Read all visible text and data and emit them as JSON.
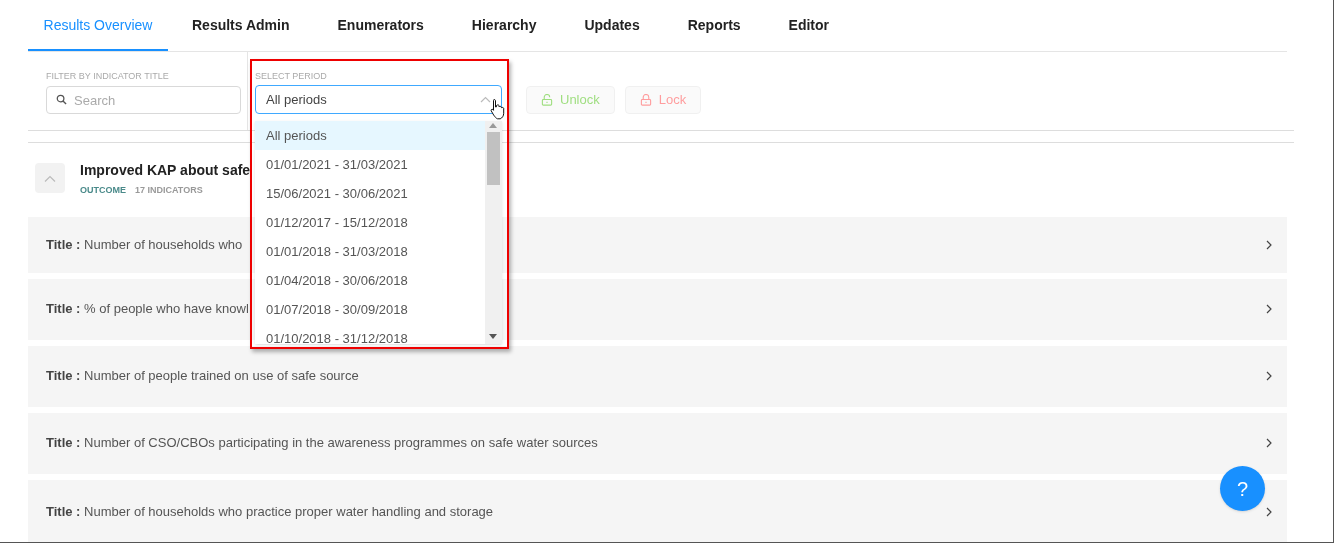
{
  "tabs": [
    {
      "label": "Results Overview",
      "selected": true
    },
    {
      "label": "Results Admin",
      "selected": false
    },
    {
      "label": "Enumerators",
      "selected": false
    },
    {
      "label": "Hierarchy",
      "selected": false
    },
    {
      "label": "Updates",
      "selected": false
    },
    {
      "label": "Reports",
      "selected": false
    },
    {
      "label": "Editor",
      "selected": false
    }
  ],
  "filter": {
    "label": "FILTER BY INDICATOR TITLE",
    "placeholder": "Search"
  },
  "period": {
    "label": "SELECT PERIOD",
    "value": "All periods",
    "expanded": true,
    "options": [
      {
        "label": "All periods",
        "selected": true
      },
      {
        "label": "01/01/2021 - 31/03/2021",
        "selected": false
      },
      {
        "label": "15/06/2021 - 30/06/2021",
        "selected": false
      },
      {
        "label": "01/12/2017 - 15/12/2018",
        "selected": false
      },
      {
        "label": "01/01/2018 - 31/03/2018",
        "selected": false
      },
      {
        "label": "01/04/2018 - 30/06/2018",
        "selected": false
      },
      {
        "label": "01/07/2018 - 30/09/2018",
        "selected": false
      },
      {
        "label": "01/10/2018 - 31/12/2018",
        "selected": false
      }
    ]
  },
  "actions": [
    {
      "label": "Unlock",
      "kind": "unlock",
      "disabled": true
    },
    {
      "label": "Lock",
      "kind": "lock",
      "disabled": true
    }
  ],
  "result": {
    "title": "Improved KAP about safe",
    "type": "OUTCOME",
    "count": "17 INDICATORS",
    "expanded": true,
    "indicators": [
      {
        "label": "Title :",
        "title": "Number of households who"
      },
      {
        "label": "Title :",
        "title": "% of people who have knowl"
      },
      {
        "label": "Title :",
        "title": "Number of people trained on use of safe source"
      },
      {
        "label": "Title :",
        "title": "Number of CSO/CBOs participating in the awareness programmes on safe water sources"
      },
      {
        "label": "Title :",
        "title": "Number of households who practice proper water handling and storage"
      }
    ]
  },
  "help_button": "?"
}
